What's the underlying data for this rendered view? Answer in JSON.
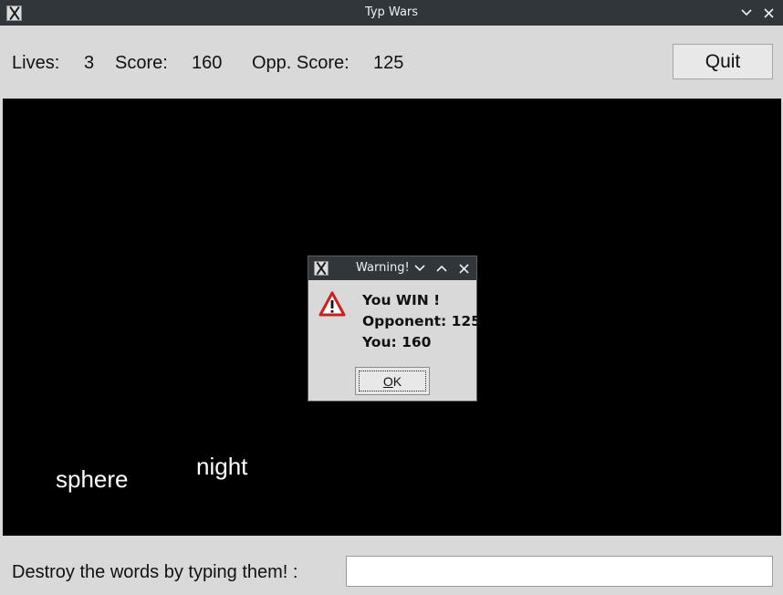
{
  "window": {
    "title": "Typ Wars",
    "icon": "x-app-icon",
    "controls": [
      "minimize-icon",
      "close-icon"
    ]
  },
  "scoreboard": {
    "lives_label": "Lives:",
    "lives_value": "3",
    "score_label": "Score:",
    "score_value": "160",
    "opp_label": "Opp. Score:",
    "opp_value": "125"
  },
  "quit_label": "Quit",
  "arena": {
    "background": "#000000",
    "words": [
      "sphere",
      "night"
    ]
  },
  "input": {
    "prompt": "Destroy the words by typing them! :",
    "value": ""
  },
  "dialog": {
    "title": "Warning!",
    "icon": "warning-triangle-icon",
    "lines": [
      "You WIN !",
      "Opponent: 125",
      "You: 160"
    ],
    "ok_mnemonic": "O",
    "ok_rest": "K"
  },
  "colors": {
    "titlebar": "#31363b",
    "panel": "#d9d9d9",
    "warning": "#cc1f1f"
  }
}
